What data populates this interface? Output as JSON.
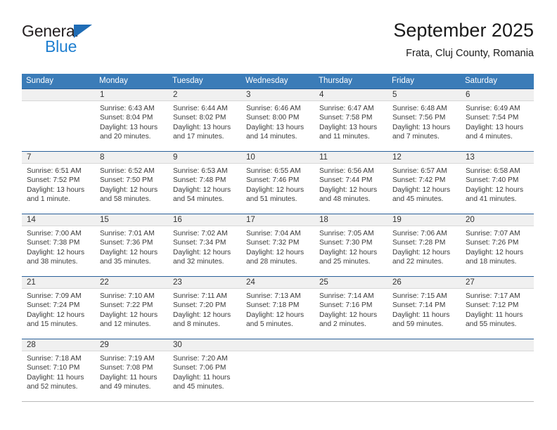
{
  "brand": {
    "name_top": "General",
    "name_bottom": "Blue",
    "triangle_icon": "brand-triangle-icon",
    "colors": {
      "dark": "#231f20",
      "blue": "#1f7fd0",
      "triangle": "#1f6cb5"
    }
  },
  "header": {
    "title": "September 2025",
    "subtitle": "Frata, Cluj County, Romania"
  },
  "theme": {
    "header_blue": "#3b7cb8",
    "row_rule_blue": "#2a6099",
    "daynum_band": "#f0f0f0",
    "text": "#3a3a3a"
  },
  "weekday_headers": [
    "Sunday",
    "Monday",
    "Tuesday",
    "Wednesday",
    "Thursday",
    "Friday",
    "Saturday"
  ],
  "weeks": [
    [
      {
        "empty": true,
        "day": "",
        "sunrise": "",
        "sunset": "",
        "daylight1": "",
        "daylight2": ""
      },
      {
        "empty": false,
        "day": "1",
        "sunrise": "Sunrise: 6:43 AM",
        "sunset": "Sunset: 8:04 PM",
        "daylight1": "Daylight: 13 hours",
        "daylight2": "and 20 minutes."
      },
      {
        "empty": false,
        "day": "2",
        "sunrise": "Sunrise: 6:44 AM",
        "sunset": "Sunset: 8:02 PM",
        "daylight1": "Daylight: 13 hours",
        "daylight2": "and 17 minutes."
      },
      {
        "empty": false,
        "day": "3",
        "sunrise": "Sunrise: 6:46 AM",
        "sunset": "Sunset: 8:00 PM",
        "daylight1": "Daylight: 13 hours",
        "daylight2": "and 14 minutes."
      },
      {
        "empty": false,
        "day": "4",
        "sunrise": "Sunrise: 6:47 AM",
        "sunset": "Sunset: 7:58 PM",
        "daylight1": "Daylight: 13 hours",
        "daylight2": "and 11 minutes."
      },
      {
        "empty": false,
        "day": "5",
        "sunrise": "Sunrise: 6:48 AM",
        "sunset": "Sunset: 7:56 PM",
        "daylight1": "Daylight: 13 hours",
        "daylight2": "and 7 minutes."
      },
      {
        "empty": false,
        "day": "6",
        "sunrise": "Sunrise: 6:49 AM",
        "sunset": "Sunset: 7:54 PM",
        "daylight1": "Daylight: 13 hours",
        "daylight2": "and 4 minutes."
      }
    ],
    [
      {
        "empty": false,
        "day": "7",
        "sunrise": "Sunrise: 6:51 AM",
        "sunset": "Sunset: 7:52 PM",
        "daylight1": "Daylight: 13 hours",
        "daylight2": "and 1 minute."
      },
      {
        "empty": false,
        "day": "8",
        "sunrise": "Sunrise: 6:52 AM",
        "sunset": "Sunset: 7:50 PM",
        "daylight1": "Daylight: 12 hours",
        "daylight2": "and 58 minutes."
      },
      {
        "empty": false,
        "day": "9",
        "sunrise": "Sunrise: 6:53 AM",
        "sunset": "Sunset: 7:48 PM",
        "daylight1": "Daylight: 12 hours",
        "daylight2": "and 54 minutes."
      },
      {
        "empty": false,
        "day": "10",
        "sunrise": "Sunrise: 6:55 AM",
        "sunset": "Sunset: 7:46 PM",
        "daylight1": "Daylight: 12 hours",
        "daylight2": "and 51 minutes."
      },
      {
        "empty": false,
        "day": "11",
        "sunrise": "Sunrise: 6:56 AM",
        "sunset": "Sunset: 7:44 PM",
        "daylight1": "Daylight: 12 hours",
        "daylight2": "and 48 minutes."
      },
      {
        "empty": false,
        "day": "12",
        "sunrise": "Sunrise: 6:57 AM",
        "sunset": "Sunset: 7:42 PM",
        "daylight1": "Daylight: 12 hours",
        "daylight2": "and 45 minutes."
      },
      {
        "empty": false,
        "day": "13",
        "sunrise": "Sunrise: 6:58 AM",
        "sunset": "Sunset: 7:40 PM",
        "daylight1": "Daylight: 12 hours",
        "daylight2": "and 41 minutes."
      }
    ],
    [
      {
        "empty": false,
        "day": "14",
        "sunrise": "Sunrise: 7:00 AM",
        "sunset": "Sunset: 7:38 PM",
        "daylight1": "Daylight: 12 hours",
        "daylight2": "and 38 minutes."
      },
      {
        "empty": false,
        "day": "15",
        "sunrise": "Sunrise: 7:01 AM",
        "sunset": "Sunset: 7:36 PM",
        "daylight1": "Daylight: 12 hours",
        "daylight2": "and 35 minutes."
      },
      {
        "empty": false,
        "day": "16",
        "sunrise": "Sunrise: 7:02 AM",
        "sunset": "Sunset: 7:34 PM",
        "daylight1": "Daylight: 12 hours",
        "daylight2": "and 32 minutes."
      },
      {
        "empty": false,
        "day": "17",
        "sunrise": "Sunrise: 7:04 AM",
        "sunset": "Sunset: 7:32 PM",
        "daylight1": "Daylight: 12 hours",
        "daylight2": "and 28 minutes."
      },
      {
        "empty": false,
        "day": "18",
        "sunrise": "Sunrise: 7:05 AM",
        "sunset": "Sunset: 7:30 PM",
        "daylight1": "Daylight: 12 hours",
        "daylight2": "and 25 minutes."
      },
      {
        "empty": false,
        "day": "19",
        "sunrise": "Sunrise: 7:06 AM",
        "sunset": "Sunset: 7:28 PM",
        "daylight1": "Daylight: 12 hours",
        "daylight2": "and 22 minutes."
      },
      {
        "empty": false,
        "day": "20",
        "sunrise": "Sunrise: 7:07 AM",
        "sunset": "Sunset: 7:26 PM",
        "daylight1": "Daylight: 12 hours",
        "daylight2": "and 18 minutes."
      }
    ],
    [
      {
        "empty": false,
        "day": "21",
        "sunrise": "Sunrise: 7:09 AM",
        "sunset": "Sunset: 7:24 PM",
        "daylight1": "Daylight: 12 hours",
        "daylight2": "and 15 minutes."
      },
      {
        "empty": false,
        "day": "22",
        "sunrise": "Sunrise: 7:10 AM",
        "sunset": "Sunset: 7:22 PM",
        "daylight1": "Daylight: 12 hours",
        "daylight2": "and 12 minutes."
      },
      {
        "empty": false,
        "day": "23",
        "sunrise": "Sunrise: 7:11 AM",
        "sunset": "Sunset: 7:20 PM",
        "daylight1": "Daylight: 12 hours",
        "daylight2": "and 8 minutes."
      },
      {
        "empty": false,
        "day": "24",
        "sunrise": "Sunrise: 7:13 AM",
        "sunset": "Sunset: 7:18 PM",
        "daylight1": "Daylight: 12 hours",
        "daylight2": "and 5 minutes."
      },
      {
        "empty": false,
        "day": "25",
        "sunrise": "Sunrise: 7:14 AM",
        "sunset": "Sunset: 7:16 PM",
        "daylight1": "Daylight: 12 hours",
        "daylight2": "and 2 minutes."
      },
      {
        "empty": false,
        "day": "26",
        "sunrise": "Sunrise: 7:15 AM",
        "sunset": "Sunset: 7:14 PM",
        "daylight1": "Daylight: 11 hours",
        "daylight2": "and 59 minutes."
      },
      {
        "empty": false,
        "day": "27",
        "sunrise": "Sunrise: 7:17 AM",
        "sunset": "Sunset: 7:12 PM",
        "daylight1": "Daylight: 11 hours",
        "daylight2": "and 55 minutes."
      }
    ],
    [
      {
        "empty": false,
        "day": "28",
        "sunrise": "Sunrise: 7:18 AM",
        "sunset": "Sunset: 7:10 PM",
        "daylight1": "Daylight: 11 hours",
        "daylight2": "and 52 minutes."
      },
      {
        "empty": false,
        "day": "29",
        "sunrise": "Sunrise: 7:19 AM",
        "sunset": "Sunset: 7:08 PM",
        "daylight1": "Daylight: 11 hours",
        "daylight2": "and 49 minutes."
      },
      {
        "empty": false,
        "day": "30",
        "sunrise": "Sunrise: 7:20 AM",
        "sunset": "Sunset: 7:06 PM",
        "daylight1": "Daylight: 11 hours",
        "daylight2": "and 45 minutes."
      },
      {
        "empty": true,
        "day": "",
        "sunrise": "",
        "sunset": "",
        "daylight1": "",
        "daylight2": ""
      },
      {
        "empty": true,
        "day": "",
        "sunrise": "",
        "sunset": "",
        "daylight1": "",
        "daylight2": ""
      },
      {
        "empty": true,
        "day": "",
        "sunrise": "",
        "sunset": "",
        "daylight1": "",
        "daylight2": ""
      },
      {
        "empty": true,
        "day": "",
        "sunrise": "",
        "sunset": "",
        "daylight1": "",
        "daylight2": ""
      }
    ]
  ]
}
